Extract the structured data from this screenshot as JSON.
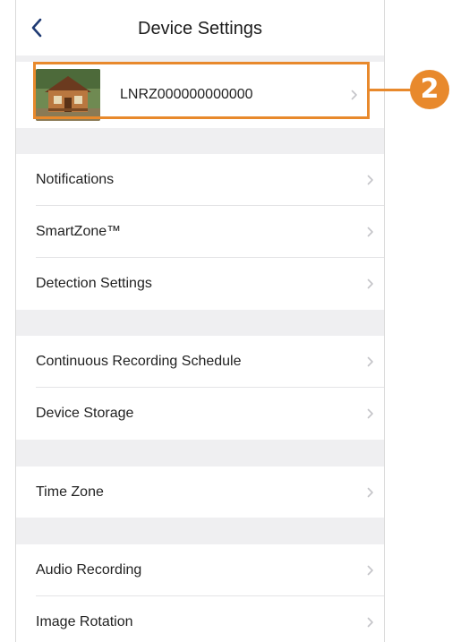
{
  "header": {
    "title": "Device Settings"
  },
  "device": {
    "name": "LNRZ000000000000"
  },
  "groups": [
    {
      "items": [
        {
          "label": "Notifications"
        },
        {
          "label": "SmartZone™"
        },
        {
          "label": "Detection Settings"
        }
      ]
    },
    {
      "items": [
        {
          "label": "Continuous Recording Schedule"
        },
        {
          "label": "Device Storage"
        }
      ]
    },
    {
      "items": [
        {
          "label": "Time Zone"
        }
      ]
    },
    {
      "items": [
        {
          "label": "Audio Recording"
        },
        {
          "label": "Image Rotation"
        }
      ]
    }
  ],
  "callout": {
    "number": "2"
  },
  "colors": {
    "accent": "#e8892c",
    "separator": "#efeff1",
    "chevron": "#c4c4c8",
    "back": "#1f3a73"
  }
}
